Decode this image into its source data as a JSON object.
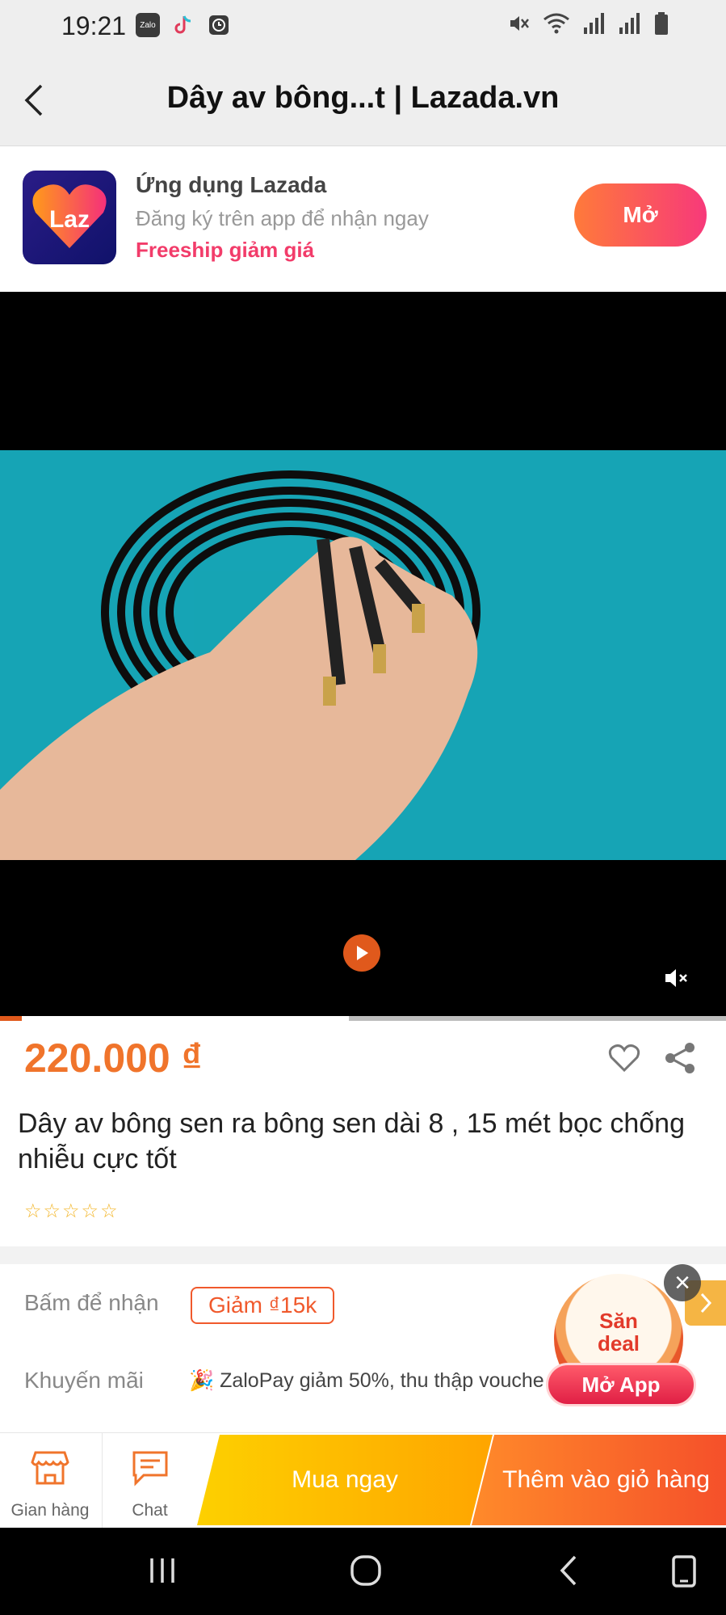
{
  "status_bar": {
    "time": "19:21",
    "apps": [
      "Zalo",
      "TikTok",
      "Clock"
    ]
  },
  "title_bar": {
    "title": "Dây av bông...t | Lazada.vn",
    "back_icon": "chevron-left-icon"
  },
  "app_banner": {
    "logo_text": "Laz",
    "title": "Ứng dụng Lazada",
    "subtitle": "Đăng ký trên app để nhận ngay",
    "promo": "Freeship giảm giá",
    "open_label": "Mở"
  },
  "video": {
    "progress_fraction": 0.03,
    "buffered_fraction": 0.48,
    "muted": true
  },
  "product": {
    "price": "220.000 ₫",
    "title": "Dây av bông sen ra bông sen dài 8 , 15 mét bọc chống nhiễu cực tốt",
    "rating_stars": 0,
    "stars": [
      "☆",
      "☆",
      "☆",
      "☆",
      "☆"
    ]
  },
  "promotions": {
    "voucher_label": "Bấm để nhận",
    "voucher_value": "Giảm ₫15k",
    "promo_label": "Khuyến mãi",
    "promo_text": "🎉 ZaloPay giảm 50%, thu thập vouche"
  },
  "deal_badge": {
    "line1": "Săn",
    "line2": "deal",
    "button": "Mở App",
    "close": "×"
  },
  "bottom_bar": {
    "shop_label": "Gian hàng",
    "chat_label": "Chat",
    "buy_now": "Mua ngay",
    "add_to_cart": "Thêm vào giỏ hàng"
  },
  "colors": {
    "accent": "#f0742b",
    "lazada_pink": "#f7397a",
    "buy_now": "#fdd000",
    "add_cart": "#f5502a"
  }
}
